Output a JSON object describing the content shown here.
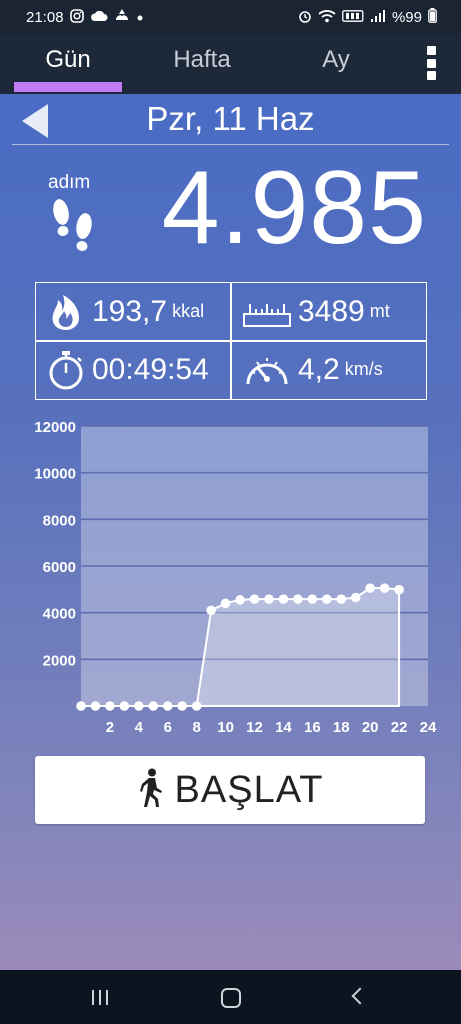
{
  "status_bar": {
    "time": "21:08",
    "battery": "%99",
    "left_icons": [
      "instagram-icon",
      "cloud-icon",
      "weather-icon",
      "notification-dot-icon"
    ],
    "right_icons": [
      "alarm-icon",
      "wifi-icon",
      "volte-icon",
      "signal-icon",
      "battery-icon"
    ]
  },
  "tabs": [
    {
      "label": "Gün",
      "active": true
    },
    {
      "label": "Hafta",
      "active": false
    },
    {
      "label": "Ay",
      "active": false
    }
  ],
  "accent_color": "#c27df4",
  "date_nav": {
    "date": "Pzr, 11 Haz"
  },
  "steps": {
    "label": "adım",
    "value": "4.985"
  },
  "stats": {
    "calories": {
      "value": "193,7",
      "unit": "kkal",
      "icon": "flame-icon"
    },
    "distance": {
      "value": "3489",
      "unit": "mt",
      "icon": "ruler-icon"
    },
    "duration": {
      "value": "00:49:54",
      "icon": "stopwatch-icon"
    },
    "speed": {
      "value": "4,2",
      "unit": "km/s",
      "icon": "speedometer-icon"
    }
  },
  "chart_data": {
    "type": "area",
    "y_tick_labels": [
      "12000",
      "10000",
      "8000",
      "6000",
      "4000",
      "2000"
    ],
    "x_tick_labels": [
      "2",
      "4",
      "6",
      "8",
      "10",
      "12",
      "14",
      "16",
      "18",
      "20",
      "22",
      "24"
    ],
    "ylim": [
      0,
      12000
    ],
    "xlim": [
      0,
      24
    ],
    "grid": true,
    "x": [
      0,
      1,
      2,
      3,
      4,
      5,
      6,
      7,
      8,
      9,
      10,
      11,
      12,
      13,
      14,
      15,
      16,
      17,
      18,
      19,
      20,
      21,
      22
    ],
    "values": [
      0,
      0,
      0,
      0,
      0,
      0,
      0,
      0,
      0,
      4100,
      4400,
      4550,
      4580,
      4580,
      4580,
      4580,
      4580,
      4580,
      4580,
      4650,
      5050,
      5050,
      4985
    ]
  },
  "start_button": {
    "label": "BAŞLAT",
    "icon": "walking-person-icon"
  }
}
